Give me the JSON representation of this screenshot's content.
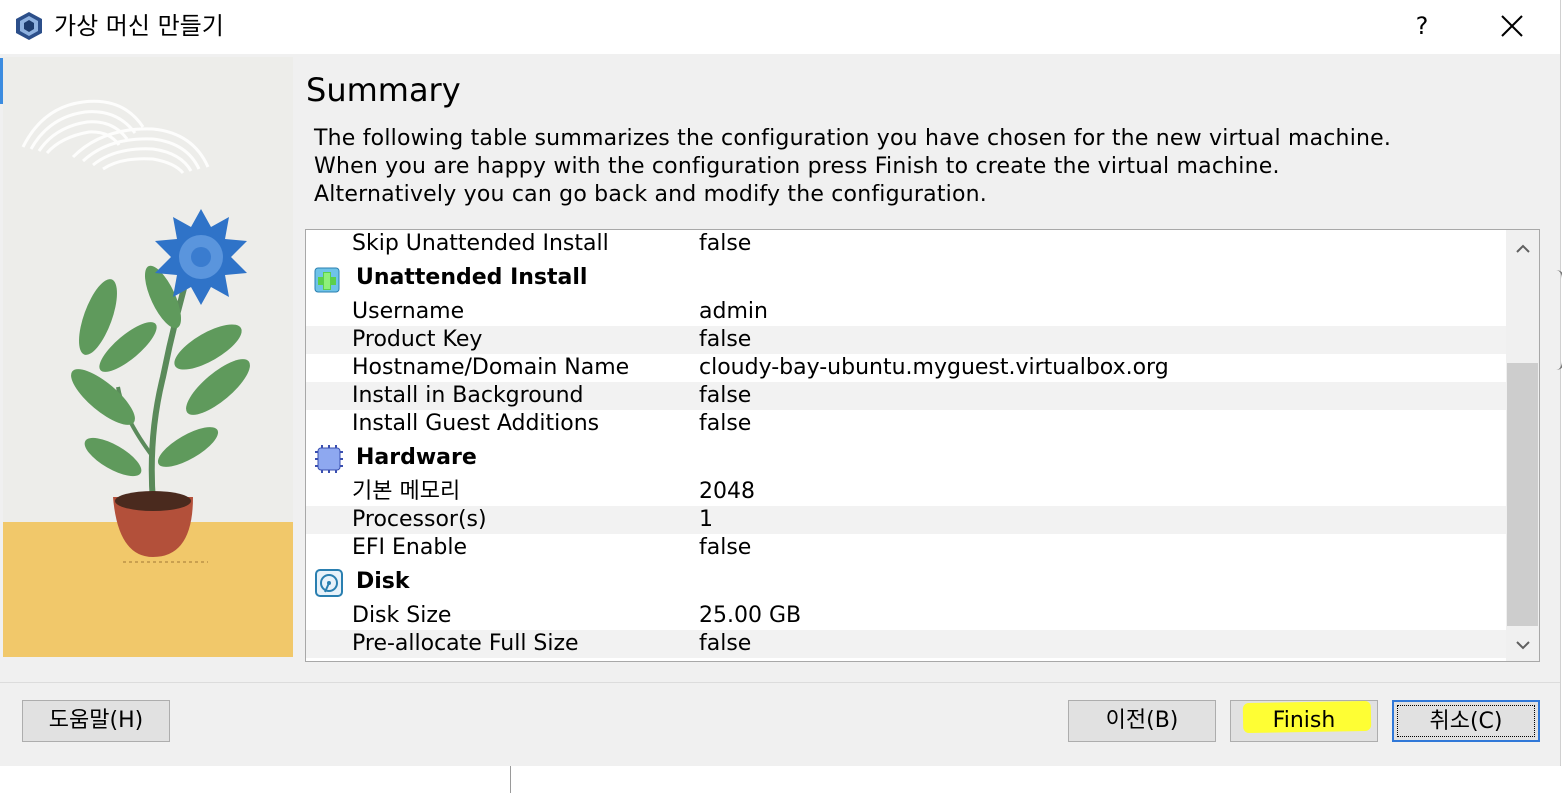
{
  "window": {
    "title": "가상 머신 만들기",
    "help_label": "?",
    "close_label": "✕"
  },
  "page": {
    "heading": "Summary",
    "description": [
      "The following table summarizes the configuration you have chosen for the new virtual machine.",
      "When you are happy with the configuration press Finish to create the virtual machine.",
      "Alternatively you can go back and modify the configuration."
    ]
  },
  "summary_table": {
    "rows": [
      {
        "type": "item",
        "key": "Skip Unattended Install",
        "value": "false"
      },
      {
        "type": "section",
        "key": "Unattended Install",
        "icon": "unattended-install-icon"
      },
      {
        "type": "item",
        "key": "Username",
        "value": "admin"
      },
      {
        "type": "item",
        "key": "Product Key",
        "value": "false"
      },
      {
        "type": "item",
        "key": "Hostname/Domain Name",
        "value": "cloudy-bay-ubuntu.myguest.virtualbox.org"
      },
      {
        "type": "item",
        "key": "Install in Background",
        "value": "false"
      },
      {
        "type": "item",
        "key": "Install Guest Additions",
        "value": "false"
      },
      {
        "type": "section",
        "key": "Hardware",
        "icon": "hardware-chip-icon"
      },
      {
        "type": "item",
        "key": "기본 메모리",
        "value": "2048"
      },
      {
        "type": "item",
        "key": "Processor(s)",
        "value": "1"
      },
      {
        "type": "item",
        "key": "EFI Enable",
        "value": "false"
      },
      {
        "type": "section",
        "key": "Disk",
        "icon": "disk-icon"
      },
      {
        "type": "item",
        "key": "Disk Size",
        "value": "25.00 GB"
      },
      {
        "type": "item",
        "key": "Pre-allocate Full Size",
        "value": "false"
      }
    ],
    "scroll_up_label": "⌃",
    "scroll_down_label": "⌄"
  },
  "buttons": {
    "help": "도움말(H)",
    "back": "이전(B)",
    "finish": "Finish",
    "cancel": "취소(C)"
  },
  "colors": {
    "highlight": "#ffff2a",
    "focus_border": "#3078d8",
    "accent": "#3c8ce0"
  }
}
